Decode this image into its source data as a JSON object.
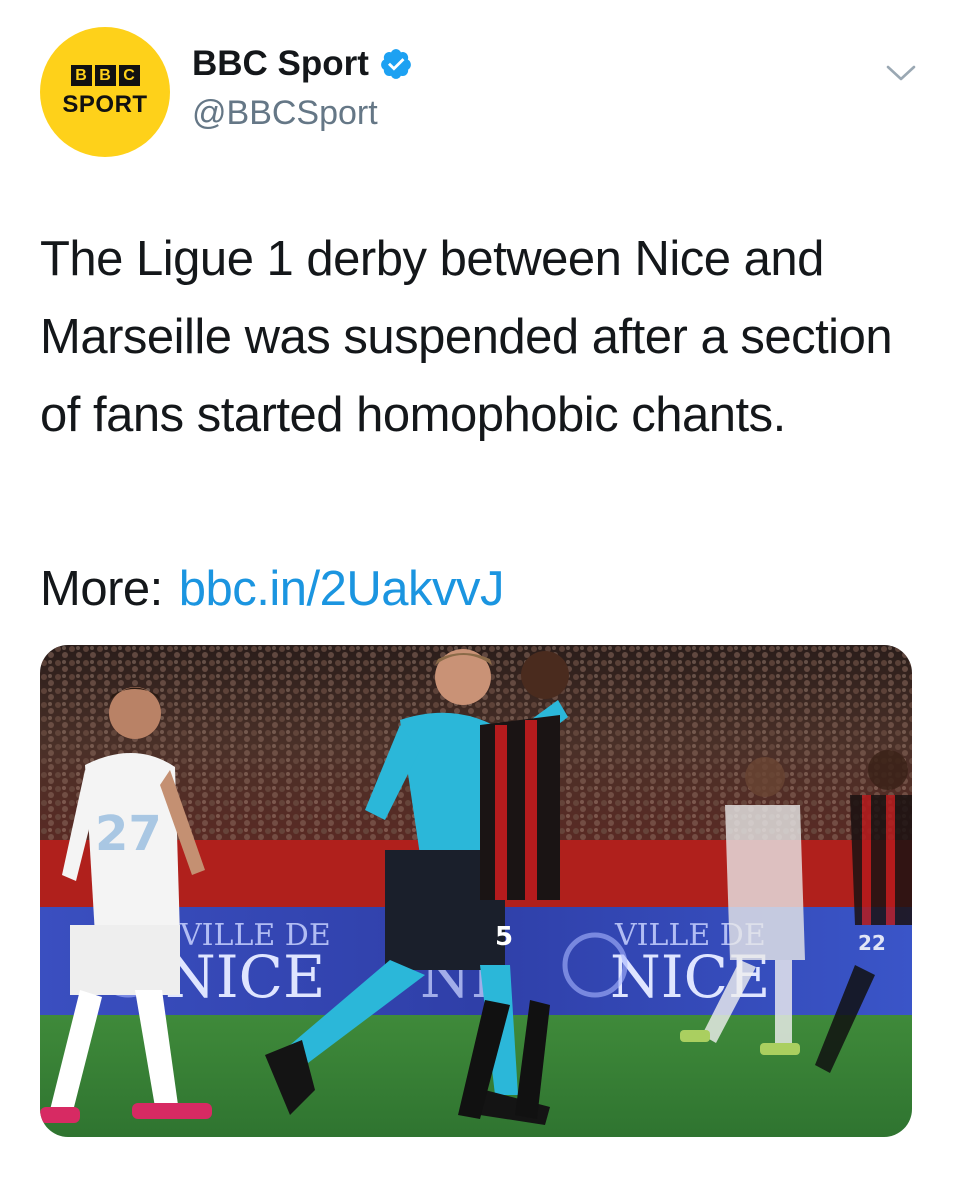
{
  "author": {
    "display_name": "BBC Sport",
    "handle": "@BBCSport",
    "verified": true,
    "avatar": {
      "letters": [
        "B",
        "B",
        "C"
      ],
      "word": "SPORT",
      "bg_color": "#fed11a"
    }
  },
  "tweet": {
    "text": "The Ligue 1 derby between Nice and Marseille was suspended after a section of fans started homophobic chants.",
    "more_label": "More:",
    "link_text": "bbc.in/2UakvvJ",
    "link_color": "#1b95e0"
  },
  "media": {
    "boards": [
      "VILLE DE",
      "NICE",
      "NI",
      "VILLE DE",
      "NICE"
    ],
    "shirt_numbers": [
      "27",
      "5",
      "22"
    ]
  },
  "icons": {
    "menu": "chevron-down-icon",
    "verified": "verified-badge-icon"
  }
}
